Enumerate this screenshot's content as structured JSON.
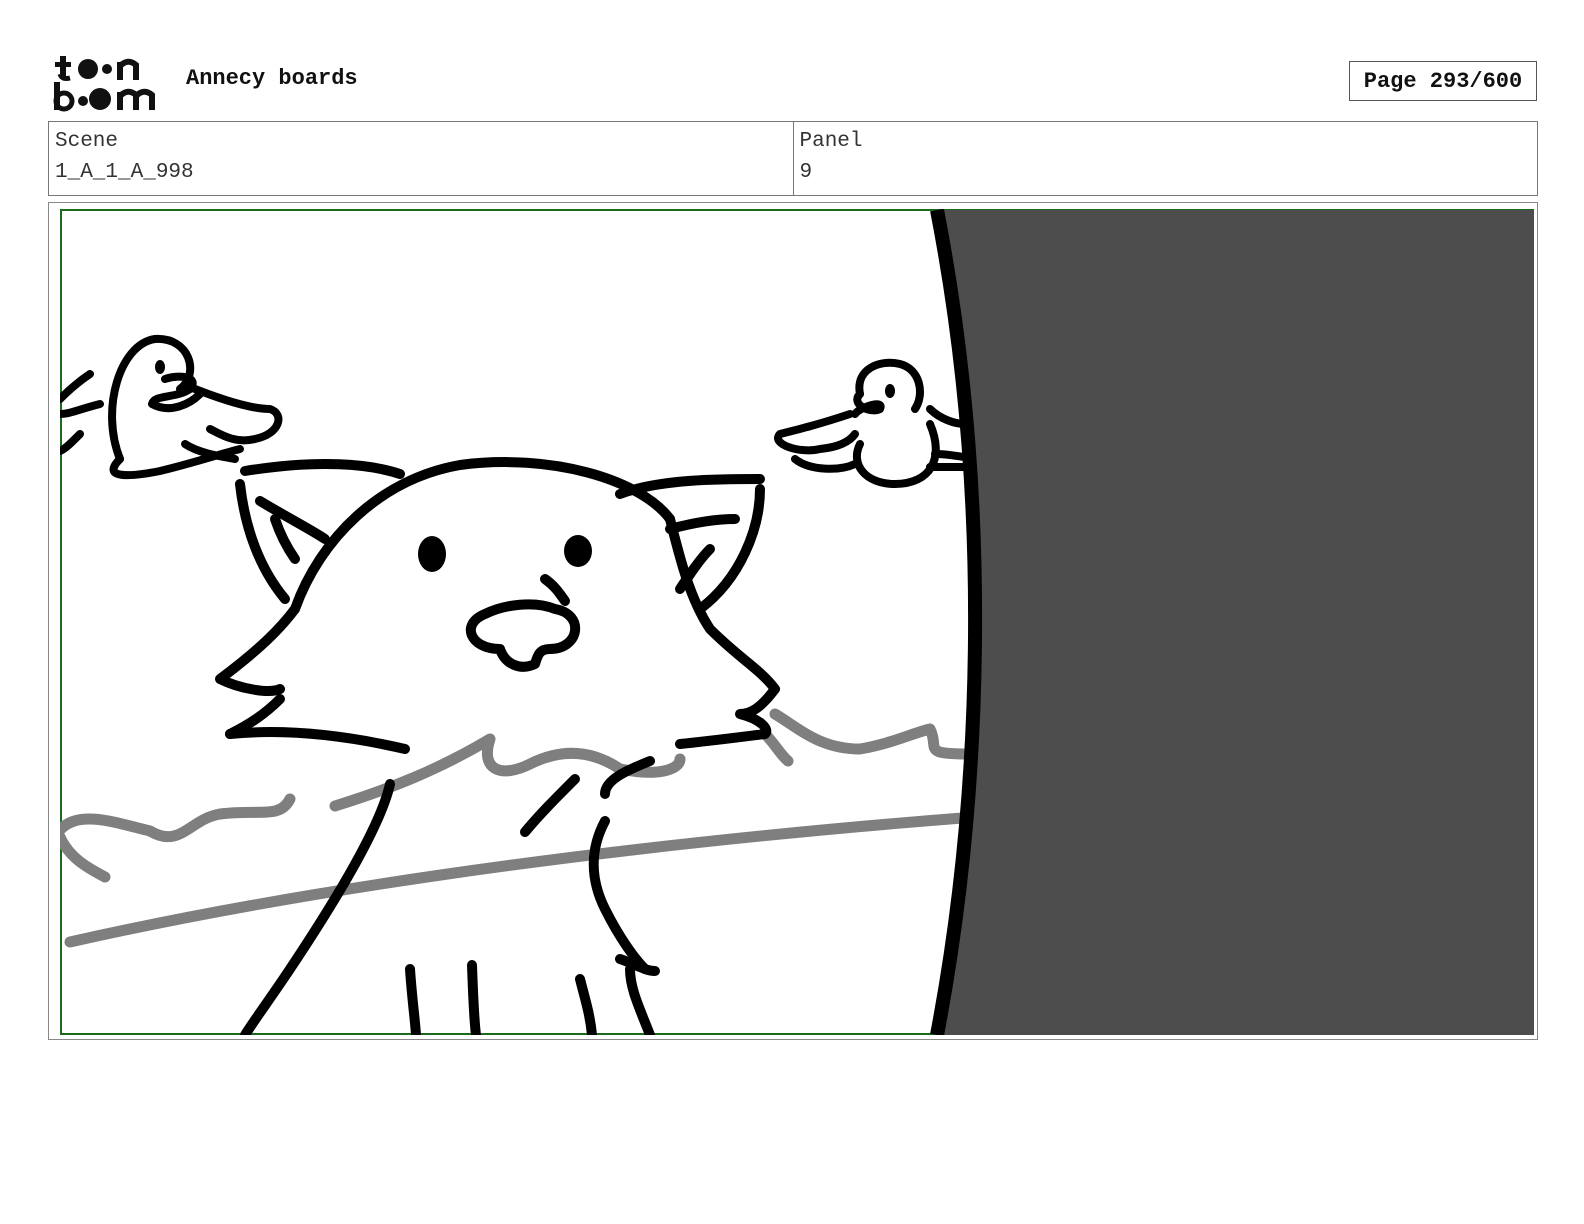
{
  "header": {
    "logo_text": "toon boom",
    "project_title": "Annecy boards",
    "page_label": "Page 293/600"
  },
  "info": {
    "scene_label": "Scene",
    "scene_value": "1_A_1_A_998",
    "panel_label": "Panel",
    "panel_value": "9"
  },
  "colors": {
    "frame_green": "#1a6b1a",
    "dark_fill": "#4d4d4d",
    "ink": "#000000",
    "gray_stroke": "#7f7f7f"
  }
}
